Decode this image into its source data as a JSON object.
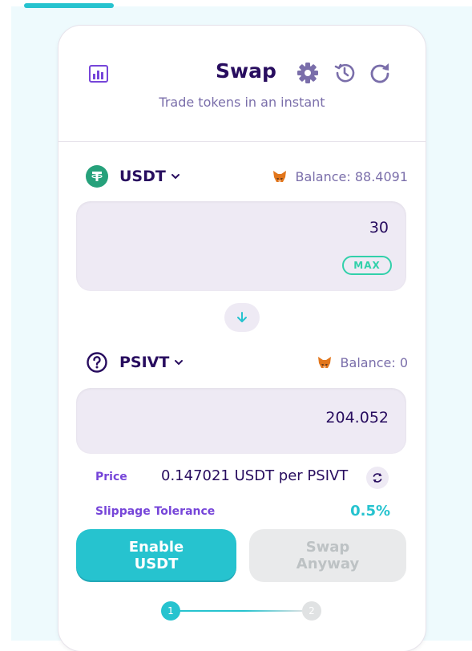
{
  "header": {
    "title": "Swap",
    "subtitle": "Trade tokens in an instant"
  },
  "from": {
    "token": "USDT",
    "balance": "Balance: 88.4091",
    "amount": "30",
    "max_label": "MAX"
  },
  "to": {
    "token": "PSIVT",
    "balance": "Balance: 0",
    "amount": "204.052"
  },
  "details": {
    "price_label": "Price",
    "price_value": "0.147021 USDT per PSIVT",
    "slippage_label": "Slippage Tolerance",
    "slippage_value": "0.5%"
  },
  "actions": {
    "enable_line1": "Enable",
    "enable_line2": "USDT",
    "swap_line1": "Swap",
    "swap_line2": "Anyway"
  },
  "stepper": {
    "step1": "1",
    "step2": "2",
    "current": 1
  },
  "colors": {
    "primary": "#26c3cf",
    "text": "#280d5f",
    "secondary_text": "#7a6eaa",
    "accent_purple": "#7645d9",
    "input_bg": "#eeeaf4",
    "tether_green": "#26a17b",
    "disabled_bg": "#e9eaeb"
  },
  "icons": {
    "chart": "chart-icon",
    "settings": "gear-icon",
    "history": "history-icon",
    "refresh": "refresh-icon",
    "usdt_logo": "tether-logo-icon",
    "unknown_token": "question-circle-icon",
    "wallet": "metamask-fox-icon",
    "swap_direction": "arrow-down-icon",
    "price_toggle": "swap-circle-icon"
  }
}
